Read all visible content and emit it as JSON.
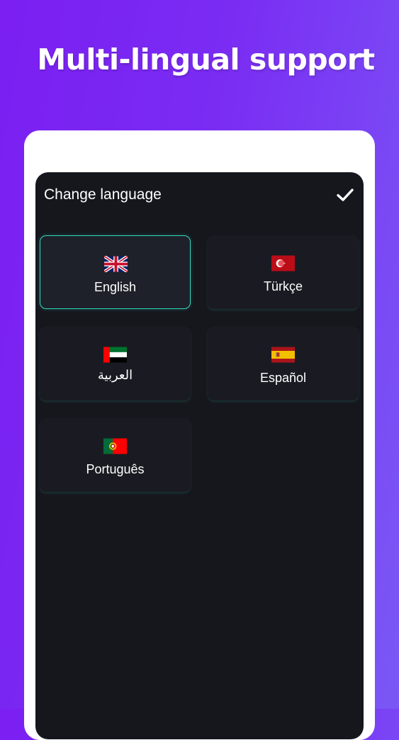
{
  "headline": "Multi-lingual support",
  "dialog": {
    "title": "Change language",
    "confirm_icon": "checkmark-icon"
  },
  "languages": [
    {
      "label": "English",
      "flag_icon": "uk-flag-icon",
      "selected": true
    },
    {
      "label": "Türkçe",
      "flag_icon": "turkey-flag-icon",
      "selected": false
    },
    {
      "label": "العربية",
      "flag_icon": "uae-flag-icon",
      "selected": false
    },
    {
      "label": "Español",
      "flag_icon": "spain-flag-icon",
      "selected": false
    },
    {
      "label": "Português",
      "flag_icon": "portugal-flag-icon",
      "selected": false
    }
  ],
  "colors": {
    "background_start": "#7b1ff2",
    "background_end": "#7a58f5",
    "screen_bg": "#16171d",
    "card_bg": "#1a1b22",
    "selected_border": "#33d6c0",
    "text": "#ffffff"
  }
}
